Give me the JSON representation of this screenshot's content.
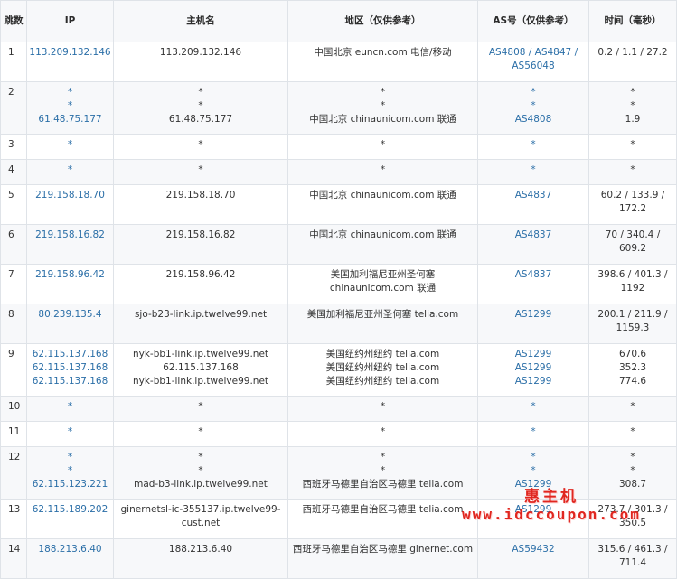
{
  "header": {
    "hop": "跳数",
    "ip": "IP",
    "hostname": "主机名",
    "region": "地区（仅供参考）",
    "asn": "AS号（仅供参考）",
    "time": "时间（毫秒）"
  },
  "rows": [
    {
      "hop": "1",
      "ip": [
        "113.209.132.146"
      ],
      "host": [
        "113.209.132.146"
      ],
      "region": [
        "中国北京 euncn.com 电信/移动"
      ],
      "as": [
        "AS4808 / AS4847 / AS56048"
      ],
      "time": [
        "0.2 / 1.1 / 27.2"
      ]
    },
    {
      "hop": "2",
      "ip": [
        "*",
        "*",
        "61.48.75.177"
      ],
      "host": [
        "*",
        "*",
        "61.48.75.177"
      ],
      "region": [
        "*",
        "*",
        "中国北京 chinaunicom.com 联通"
      ],
      "as": [
        "*",
        "*",
        "AS4808"
      ],
      "time": [
        "*",
        "*",
        "1.9"
      ]
    },
    {
      "hop": "3",
      "ip": [
        "*"
      ],
      "host": [
        "*"
      ],
      "region": [
        "*"
      ],
      "as": [
        "*"
      ],
      "time": [
        "*"
      ]
    },
    {
      "hop": "4",
      "ip": [
        "*"
      ],
      "host": [
        "*"
      ],
      "region": [
        "*"
      ],
      "as": [
        "*"
      ],
      "time": [
        "*"
      ]
    },
    {
      "hop": "5",
      "ip": [
        "219.158.18.70"
      ],
      "host": [
        "219.158.18.70"
      ],
      "region": [
        "中国北京 chinaunicom.com 联通"
      ],
      "as": [
        "AS4837"
      ],
      "time": [
        "60.2 / 133.9 / 172.2"
      ]
    },
    {
      "hop": "6",
      "ip": [
        "219.158.16.82"
      ],
      "host": [
        "219.158.16.82"
      ],
      "region": [
        "中国北京 chinaunicom.com 联通"
      ],
      "as": [
        "AS4837"
      ],
      "time": [
        "70 / 340.4 / 609.2"
      ]
    },
    {
      "hop": "7",
      "ip": [
        "219.158.96.42"
      ],
      "host": [
        "219.158.96.42"
      ],
      "region": [
        "美国加利福尼亚州圣何塞 chinaunicom.com 联通"
      ],
      "as": [
        "AS4837"
      ],
      "time": [
        "398.6 / 401.3 / 1192"
      ]
    },
    {
      "hop": "8",
      "ip": [
        "80.239.135.4"
      ],
      "host": [
        "sjo-b23-link.ip.twelve99.net"
      ],
      "region": [
        "美国加利福尼亚州圣何塞 telia.com"
      ],
      "as": [
        "AS1299"
      ],
      "time": [
        "200.1 / 211.9 / 1159.3"
      ]
    },
    {
      "hop": "9",
      "ip": [
        "62.115.137.168",
        "62.115.137.168",
        "62.115.137.168"
      ],
      "host": [
        "nyk-bb1-link.ip.twelve99.net",
        "62.115.137.168",
        "nyk-bb1-link.ip.twelve99.net"
      ],
      "region": [
        "美国纽约州纽约 telia.com",
        "美国纽约州纽约 telia.com",
        "美国纽约州纽约 telia.com"
      ],
      "as": [
        "AS1299",
        "AS1299",
        "AS1299"
      ],
      "time": [
        "670.6",
        "352.3",
        "774.6"
      ]
    },
    {
      "hop": "10",
      "ip": [
        "*"
      ],
      "host": [
        "*"
      ],
      "region": [
        "*"
      ],
      "as": [
        "*"
      ],
      "time": [
        "*"
      ]
    },
    {
      "hop": "11",
      "ip": [
        "*"
      ],
      "host": [
        "*"
      ],
      "region": [
        "*"
      ],
      "as": [
        "*"
      ],
      "time": [
        "*"
      ]
    },
    {
      "hop": "12",
      "ip": [
        "*",
        "*",
        "62.115.123.221"
      ],
      "host": [
        "*",
        "*",
        "mad-b3-link.ip.twelve99.net"
      ],
      "region": [
        "*",
        "*",
        "西班牙马德里自治区马德里 telia.com"
      ],
      "as": [
        "*",
        "*",
        "AS1299"
      ],
      "time": [
        "*",
        "*",
        "308.7"
      ]
    },
    {
      "hop": "13",
      "ip": [
        "62.115.189.202"
      ],
      "host": [
        "ginernetsl-ic-355137.ip.twelve99-cust.net"
      ],
      "region": [
        "西班牙马德里自治区马德里 telia.com"
      ],
      "as": [
        "AS1299"
      ],
      "time": [
        "273.7 / 301.3 / 350.5"
      ]
    },
    {
      "hop": "14",
      "ip": [
        "188.213.6.40"
      ],
      "host": [
        "188.213.6.40"
      ],
      "region": [
        "西班牙马德里自治区马德里 ginernet.com"
      ],
      "as": [
        "AS59432"
      ],
      "time": [
        "315.6 / 461.3 / 711.4"
      ]
    }
  ],
  "watermark": {
    "cn": "惠主机",
    "url": "www.idccoupon.com",
    "color": "#e0261f"
  }
}
